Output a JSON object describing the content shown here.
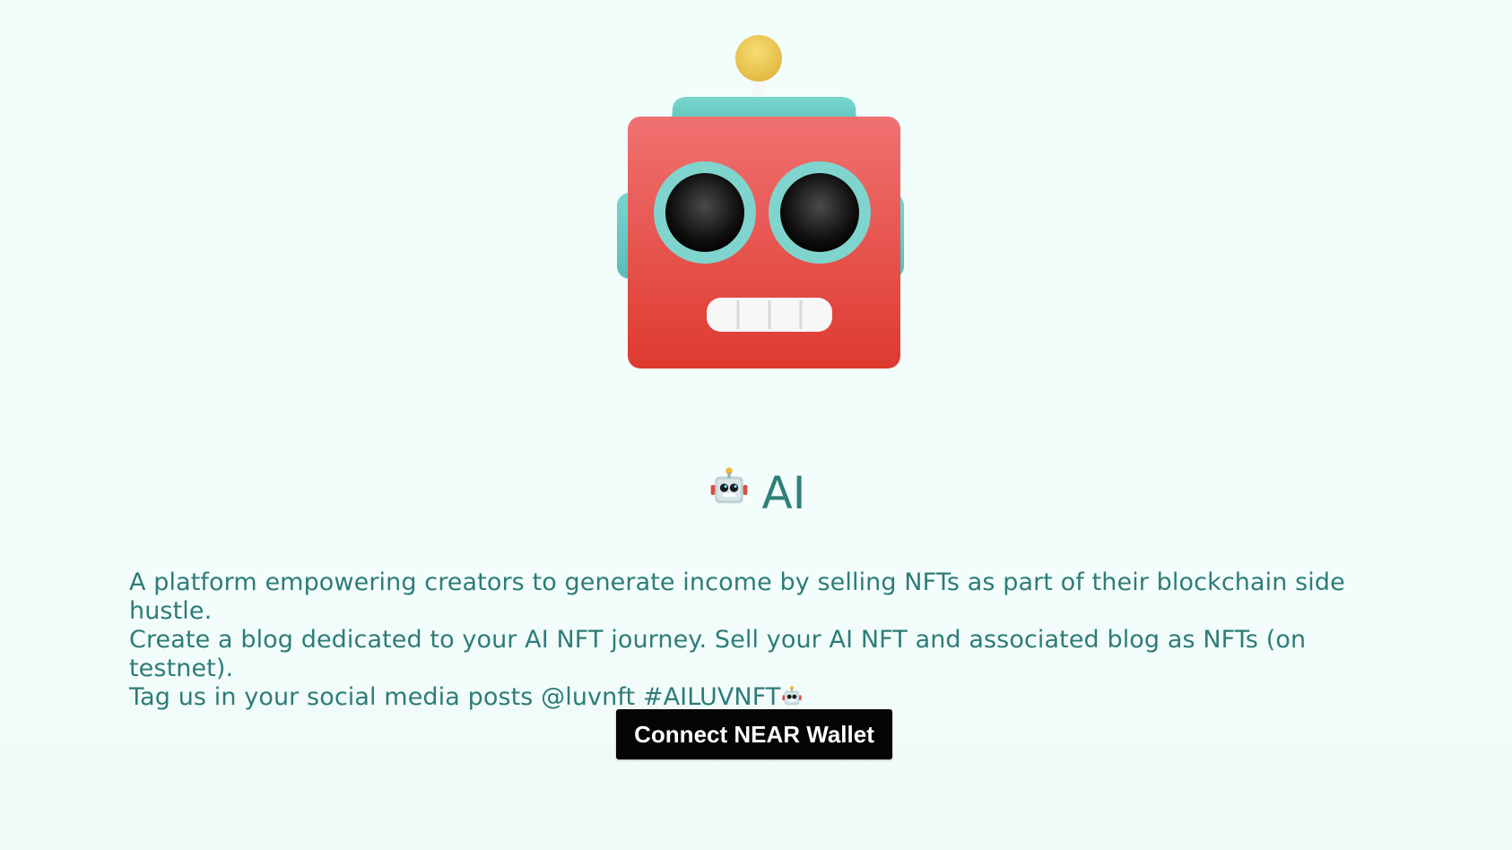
{
  "hero": {
    "image_name": "robot-head-3d-image"
  },
  "header": {
    "emoji_icon": "robot-face-emoji",
    "title": "AI"
  },
  "description": {
    "line1": "A platform empowering creators to generate income by selling NFTs as part of their blockchain side hustle.",
    "line2": "Create a blog dedicated to your AI NFT journey. Sell your AI NFT and associated blog as NFTs (on testnet).",
    "line3": "Tag us in your social media posts @luvnft #AILUVNFT"
  },
  "actions": {
    "connect_label": "Connect NEAR Wallet"
  },
  "colors": {
    "background": "#f2fefb",
    "text": "#2f7f7b",
    "button_bg": "#050505",
    "button_text": "#ffffff",
    "robot_red": "#e14f43",
    "robot_teal": "#68c8c2",
    "robot_yellow": "#e7c043"
  }
}
